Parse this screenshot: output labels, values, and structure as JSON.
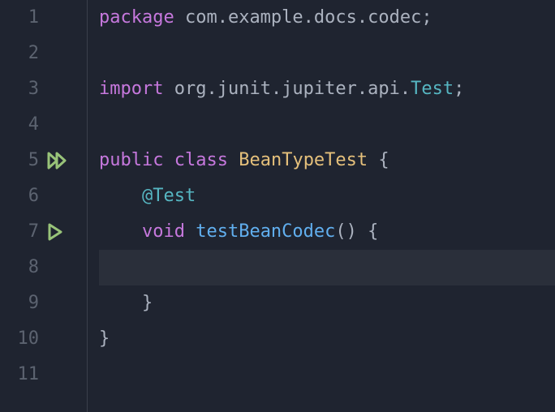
{
  "editor": {
    "lines": {
      "n1": "1",
      "n2": "2",
      "n3": "3",
      "n4": "4",
      "n5": "5",
      "n6": "6",
      "n7": "7",
      "n8": "8",
      "n9": "9",
      "n10": "10",
      "n11": "11"
    },
    "current_line": 8
  },
  "code": {
    "l1": {
      "kw": "package",
      "sp": " ",
      "pkg": "com.example.docs.codec",
      "semi": ";"
    },
    "l3": {
      "kw": "import",
      "sp": " ",
      "pkg": "org.junit.jupiter.api.",
      "type": "Test",
      "semi": ";"
    },
    "l5": {
      "kw1": "public",
      "sp1": " ",
      "kw2": "class",
      "sp2": " ",
      "type": "BeanTypeTest",
      "sp3": " ",
      "brace": "{"
    },
    "l6": {
      "indent": "    ",
      "ann": "@Test"
    },
    "l7": {
      "indent": "    ",
      "kw": "void",
      "sp": " ",
      "fn": "testBeanCodec",
      "paren": "()",
      "sp2": " ",
      "brace": "{"
    },
    "l9": {
      "indent": "    ",
      "brace": "}"
    },
    "l10": {
      "brace": "}"
    }
  },
  "icons": {
    "run_class": "run-class-icon",
    "run_test": "run-test-icon"
  }
}
